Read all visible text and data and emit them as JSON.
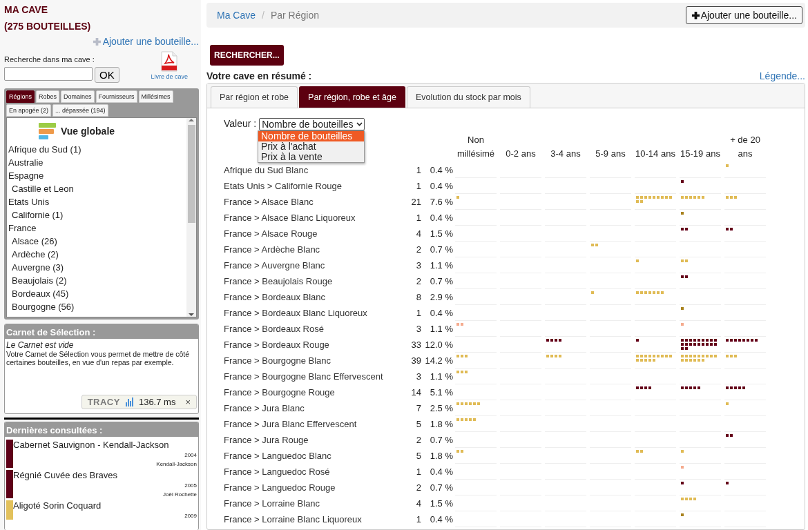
{
  "sidebar": {
    "title": "MA CAVE",
    "subtitle": "(275 BOUTEILLES)",
    "add_link": "Ajouter une bouteille...",
    "search_label": "Recherche dans ma cave :",
    "search_button": "OK",
    "pdf_link": "Livre de cave",
    "filter_tabs": [
      {
        "label": "Régions",
        "selected": true
      },
      {
        "label": "Robes",
        "selected": false
      },
      {
        "label": "Domaines",
        "selected": false
      },
      {
        "label": "Fournisseurs",
        "selected": false
      },
      {
        "label": "Millésimes",
        "selected": false
      },
      {
        "label": "En apogée (2)",
        "selected": false
      },
      {
        "label": "... dépassée (194)",
        "selected": false
      }
    ],
    "tree_header": "Vue globale",
    "tree": [
      {
        "label": "Afrique du Sud (1)"
      },
      {
        "label": "Australie"
      },
      {
        "label": "Espagne",
        "children": [
          {
            "label": "Castille et Leon"
          }
        ]
      },
      {
        "label": "Etats Unis",
        "children": [
          {
            "label": "Californie (1)"
          }
        ]
      },
      {
        "label": "France",
        "children": [
          {
            "label": "Alsace (26)"
          },
          {
            "label": "Ardèche (2)"
          },
          {
            "label": "Auvergne (3)"
          },
          {
            "label": "Beaujolais (2)"
          },
          {
            "label": "Bordeaux (45)"
          },
          {
            "label": "Bourgogne (56)"
          }
        ]
      }
    ]
  },
  "carnet": {
    "title": "Carnet de Sélection :",
    "empty": "Le Carnet est vide",
    "text": "Votre Carnet de Sélection vous permet de mettre de côté certaines bouteilles, en vue d'un repas par exemple."
  },
  "debug_bar": {
    "logo": "TRACY",
    "time": "136.7 ms",
    "close": "×"
  },
  "recent": {
    "title": "Dernières consultées :",
    "items": [
      {
        "name": "Cabernet Sauvignon - Kendall-Jackson",
        "year": "2004",
        "producer": "Kendall-Jackson",
        "color": "#5e0018"
      },
      {
        "name": "Régnié Cuvée des Braves",
        "year": "2005",
        "producer": "Joël Rochette",
        "color": "#5e0018"
      },
      {
        "name": "Aligoté Sorin Coquard",
        "year": "2009",
        "color": "#e2c15c"
      }
    ]
  },
  "breadcrumb": [
    "Ma Cave",
    "Par Région"
  ],
  "breadcrumb_separator": "/",
  "add_button": "Ajouter une bouteille...",
  "search_button": "RECHERCHER...",
  "summary_title": "Votre cave en résumé :",
  "legend_link": "Légende...",
  "tabs": [
    {
      "label": "Par région et robe",
      "selected": false
    },
    {
      "label": "Par région, robe et âge",
      "selected": true
    },
    {
      "label": "Evolution du stock par mois",
      "selected": false
    }
  ],
  "value_filter": {
    "label": "Valeur :",
    "value": "Nombre de bouteilles",
    "options": [
      {
        "label": "Nombre de bouteilles",
        "selected": true
      },
      {
        "label": "Prix à l'achat",
        "selected": false
      },
      {
        "label": "Prix à la vente",
        "selected": false
      }
    ]
  },
  "table": {
    "columns": [
      "Non millésimé",
      "0-2 ans",
      "3-4 ans",
      "5-9 ans",
      "10-14 ans",
      "15-19 ans",
      "+ de 20 ans"
    ],
    "rows": [
      {
        "label": "Afrique du Sud Blanc",
        "count": "1",
        "percent": "0.4 %",
        "color": "#e0bb55"
      },
      {
        "label": "Etats Unis > Californie Rouge",
        "count": "1",
        "percent": "0.4 %",
        "color": "#640019"
      },
      {
        "label": "France > Alsace Blanc",
        "count": "21",
        "percent": "7.6 %",
        "color": "#e0bb55"
      },
      {
        "label": "France > Alsace Blanc Liquoreux",
        "count": "1",
        "percent": "0.4 %",
        "color": "#a8821e"
      },
      {
        "label": "France > Alsace Rouge",
        "count": "4",
        "percent": "1.5 %",
        "color": "#640019"
      },
      {
        "label": "France > Ardèche Blanc",
        "count": "2",
        "percent": "0.7 %",
        "color": "#e0bb55"
      },
      {
        "label": "France > Auvergne Blanc",
        "count": "3",
        "percent": "1.1 %",
        "color": "#e0bb55"
      },
      {
        "label": "France > Beaujolais Rouge",
        "count": "2",
        "percent": "0.7 %",
        "color": "#640019"
      },
      {
        "label": "France > Bordeaux Blanc",
        "count": "8",
        "percent": "2.9 %",
        "color": "#e0bb55"
      },
      {
        "label": "France > Bordeaux Blanc Liquoreux",
        "count": "1",
        "percent": "0.4 %",
        "color": "#a8821e"
      },
      {
        "label": "France > Bordeaux Rosé",
        "count": "3",
        "percent": "1.1 %",
        "color": "#f5ab8e"
      },
      {
        "label": "France > Bordeaux Rouge",
        "count": "33",
        "percent": "12.0 %",
        "color": "#640019"
      },
      {
        "label": "France > Bourgogne Blanc",
        "count": "39",
        "percent": "14.2 %",
        "color": "#e0bb55"
      },
      {
        "label": "France > Bourgogne Blanc Effervescent",
        "count": "3",
        "percent": "1.1 %",
        "color": "#e0bb55"
      },
      {
        "label": "France > Bourgogne Rouge",
        "count": "14",
        "percent": "5.1 %",
        "color": "#640019"
      },
      {
        "label": "France > Jura Blanc",
        "count": "7",
        "percent": "2.5 %",
        "color": "#e0bb55"
      },
      {
        "label": "France > Jura Blanc Effervescent",
        "count": "5",
        "percent": "1.8 %",
        "color": "#e0bb55"
      },
      {
        "label": "France > Jura Rouge",
        "count": "2",
        "percent": "0.7 %",
        "color": "#640019"
      },
      {
        "label": "France > Languedoc Blanc",
        "count": "5",
        "percent": "1.8 %",
        "color": "#e0bb55"
      },
      {
        "label": "France > Languedoc Rosé",
        "count": "1",
        "percent": "0.4 %",
        "color": "#f5ab8e"
      },
      {
        "label": "France > Languedoc Rouge",
        "count": "2",
        "percent": "0.7 %",
        "color": "#640019"
      },
      {
        "label": "France > Lorraine Blanc",
        "count": "4",
        "percent": "1.5 %",
        "color": "#e0bb55"
      },
      {
        "label": "France > Lorraine Blanc Liquoreux",
        "count": "1",
        "percent": "0.4 %",
        "color": "#a8821e"
      }
    ]
  }
}
